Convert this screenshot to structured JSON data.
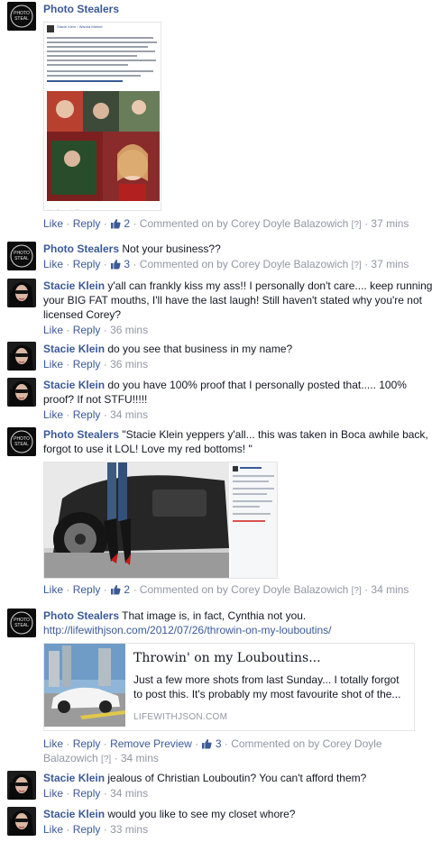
{
  "labels": {
    "like": "Like",
    "reply": "Reply",
    "remove_preview": "Remove Preview",
    "sep": "·",
    "q": "[?]"
  },
  "comments": [
    {
      "author": "Photo Stealers",
      "text": "",
      "like_count": "2",
      "commented_on": "Commented on by Corey Doyle Balazowich",
      "time": "37 mins",
      "attachment": {
        "poster": "Stacie Klein",
        "page": "Wanna Market",
        "footer": "Like · Comment · Share"
      }
    },
    {
      "author": "Photo Stealers",
      "text": "Not your business??",
      "like_count": "3",
      "commented_on": "Commented on by Corey Doyle Balazowich",
      "time": "37 mins"
    },
    {
      "author": "Stacie Klein",
      "text": "y'all can frankly kiss my ass!! I personally don't care.... keep running your BIG FAT mouths, I'll have the last laugh! Still haven't stated why you're not licensed Corey?",
      "time": "36 mins"
    },
    {
      "author": "Stacie Klein",
      "text": "do you see that business in my name?",
      "time": "36 mins"
    },
    {
      "author": "Stacie Klein",
      "text": "do you have 100% proof that I personally posted that..... 100% proof? If not STFU!!!!!",
      "time": "34 mins"
    },
    {
      "author": "Photo Stealers",
      "text": "\"Stacie Klein yeppers y'all... this was taken in Boca awhile back, forgot to use it LOL! Love my red bottoms! \"",
      "like_count": "2",
      "commented_on": "Commented on by Corey Doyle Balazowich",
      "time": "34 mins"
    },
    {
      "author": "Photo Stealers",
      "text": "That image is, in fact, Cynthia not you.",
      "link": "http://lifewithjson.com/2012/07/26/throwin-on-my-louboutins/",
      "preview": {
        "title": "Throwin' on my Louboutins...",
        "description": "Just a few more shots from last Sunday... I totally forgot to post this. It's probably my most favourite shot of the...",
        "domain": "LIFEWITHJSON.COM"
      },
      "like_count": "3",
      "commented_on_a": "Commented on by Corey Doyle",
      "commented_on_b": "Balazowich",
      "time": "34 mins"
    },
    {
      "author": "Stacie Klein",
      "text": "jealous of Christian Louboutin? You can't afford them?",
      "time": "34 mins"
    },
    {
      "author": "Stacie Klein",
      "text": "would you like to see my closet whore?",
      "time": "33 mins"
    }
  ],
  "colors": {
    "link": "#3b5998",
    "meta": "#9197a3",
    "text": "#141823"
  }
}
